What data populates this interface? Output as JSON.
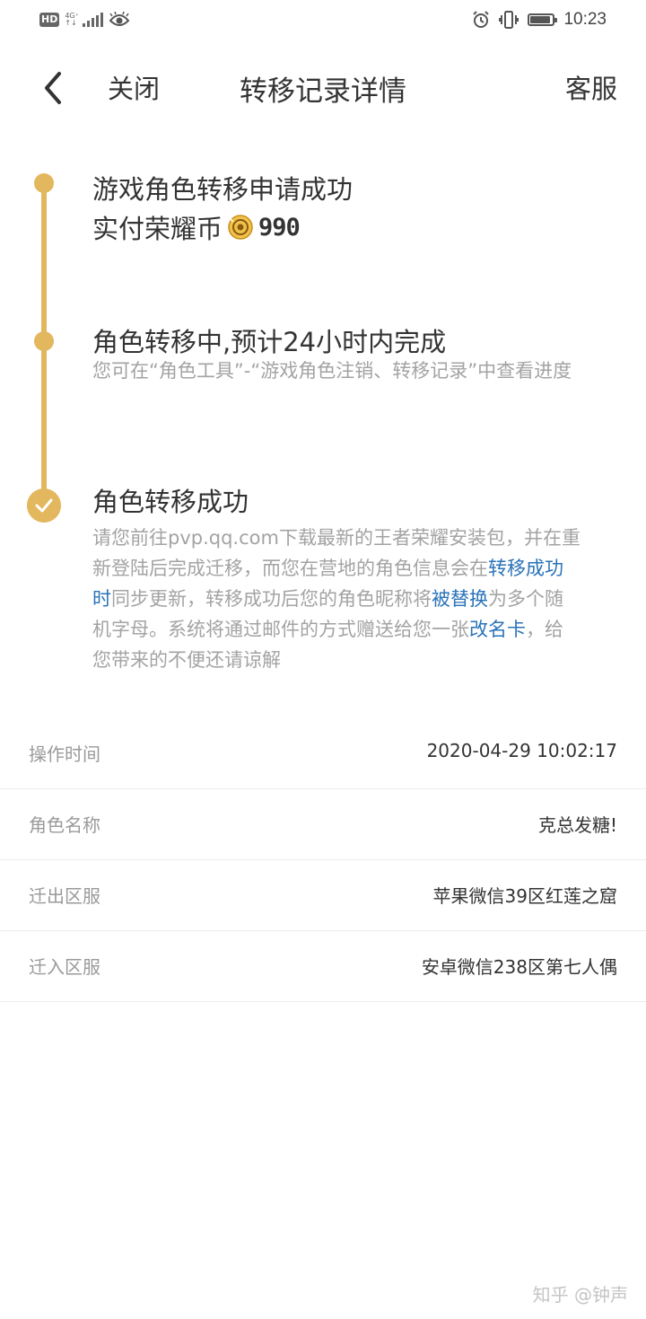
{
  "status_bar": {
    "hd": "HD",
    "network_type": "4G⁺",
    "time": "10:23",
    "battery_level": 0.9,
    "icons": [
      "eye-icon",
      "alarm-icon",
      "vibrate-icon",
      "battery-icon",
      "signal-icon"
    ]
  },
  "nav": {
    "close_label": "关闭",
    "title": "转移记录详情",
    "service_label": "客服"
  },
  "timeline": {
    "step1": {
      "title": "游戏角色转移申请成功",
      "paid_label": "实付荣耀币",
      "amount": "990"
    },
    "step2": {
      "title": "角色转移中,预计24小时内完成",
      "desc": "您可在“角色工具”-“游戏角色注销、转移记录”中查看进度"
    },
    "step3": {
      "title": "角色转移成功",
      "desc_part1": "请您前往pvp.qq.com下载最新的王者荣耀安装包，并在重新登陆后完成迁移，而您在营地的角色信息会在",
      "desc_link1": "转移成功时",
      "desc_part2": "同步更新，转移成功后您的角色昵称将",
      "desc_link2": "被替换",
      "desc_part3": "为多个随机字母。系统将通过邮件的方式赠送给您一张",
      "desc_link3": "改名卡",
      "desc_part4": "，给您带来的不便还请谅解"
    }
  },
  "details": [
    {
      "label": "操作时间",
      "value": "2020-04-29 10:02:17"
    },
    {
      "label": "角色名称",
      "value": "克总发糖!"
    },
    {
      "label": "迁出区服",
      "value": "苹果微信39区红莲之窟"
    },
    {
      "label": "迁入区服",
      "value": "安卓微信238区第七人偶"
    }
  ],
  "watermark": "知乎 @钟声",
  "colors": {
    "accent": "#e3b75e",
    "link": "#2a73b8",
    "muted": "#a3a3a3"
  }
}
